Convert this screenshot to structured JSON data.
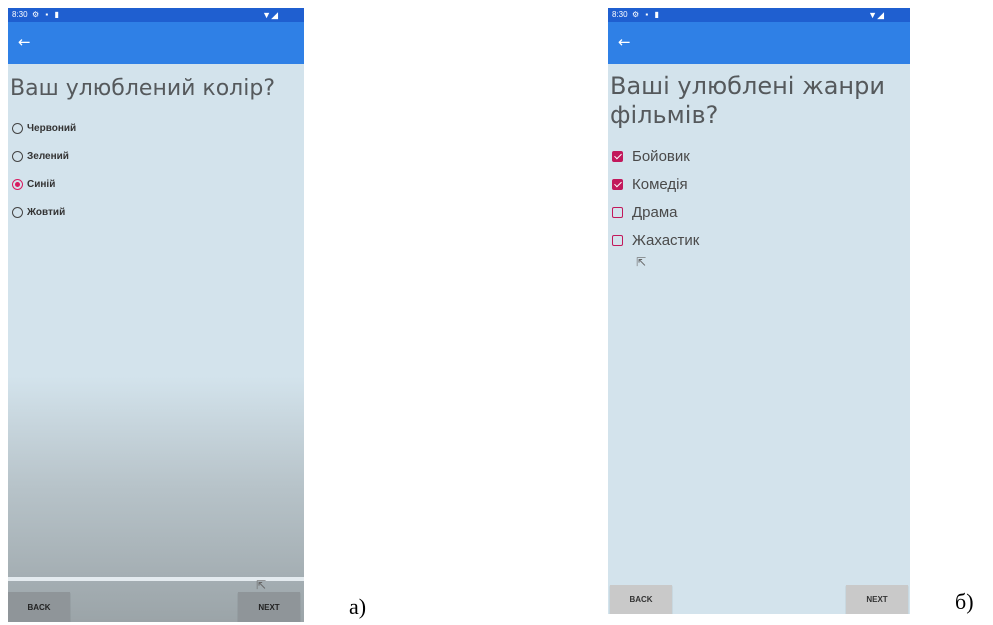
{
  "panels": [
    {
      "status_time": "8:30",
      "status_icons": "⚙ ▪ ▮",
      "signal": "▼◢",
      "back_arrow": "←",
      "question": "Ваш улюблений колір?",
      "options": [
        "Червоний",
        "Зелений",
        "Синій",
        "Жовтий"
      ],
      "selected": 2,
      "back_label": "BACK",
      "next_label": "NEXT",
      "caption": "а)"
    },
    {
      "status_time": "8:30",
      "status_icons": "⚙ ▪ ▮",
      "signal": "▼◢",
      "back_arrow": "←",
      "question": "Ваші улюблені жанри фільмів?",
      "options": [
        "Бойовик",
        "Комедія",
        "Драма",
        "Жахастик"
      ],
      "checked": [
        true,
        true,
        false,
        false
      ],
      "back_label": "BACK",
      "next_label": "NEXT",
      "caption": "б)"
    }
  ],
  "colors": {
    "status_bar": "#1f5fd0",
    "app_bar": "#2f80e6",
    "screen_bg": "#d3e3ec",
    "accent": "#d81b60"
  }
}
